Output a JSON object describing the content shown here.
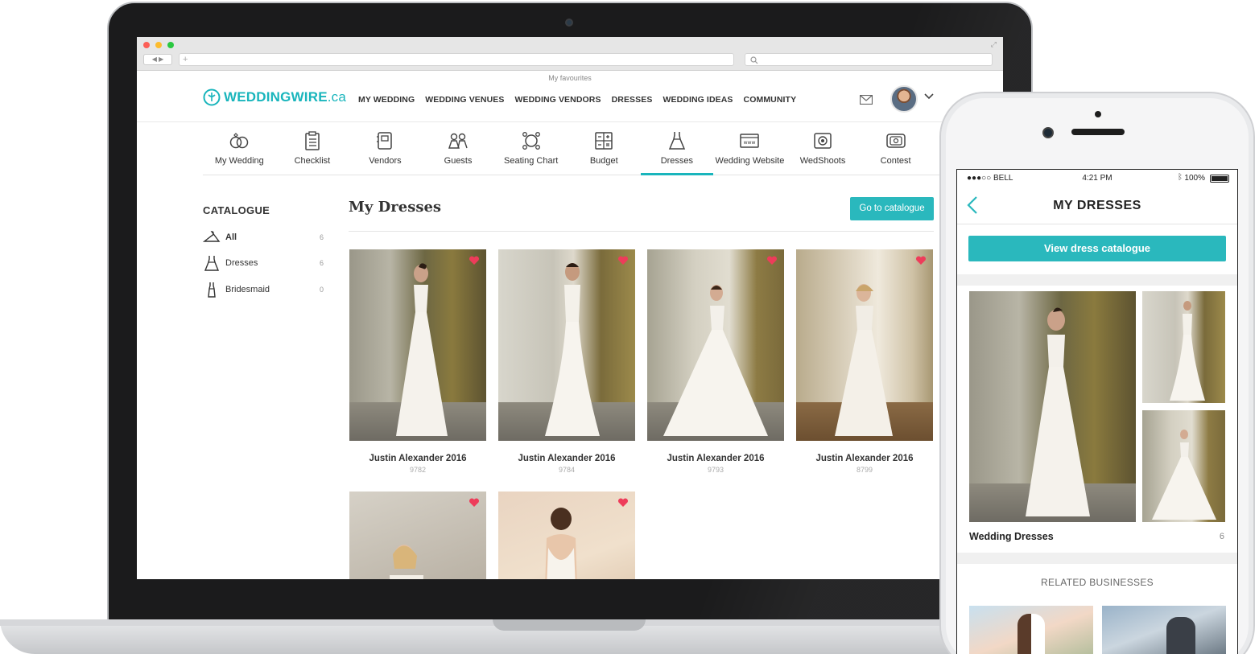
{
  "browser": {
    "favourites_label": "My favourites"
  },
  "site": {
    "logo_main": "WEDDINGWIRE",
    "logo_suffix": ".ca",
    "nav": [
      "MY WEDDING",
      "WEDDING VENUES",
      "WEDDING VENDORS",
      "DRESSES",
      "WEDDING IDEAS",
      "COMMUNITY"
    ],
    "accent_color": "#2ab8bd"
  },
  "tools": [
    {
      "label": "My Wedding",
      "icon": "rings-icon"
    },
    {
      "label": "Checklist",
      "icon": "checklist-icon"
    },
    {
      "label": "Vendors",
      "icon": "vendors-icon"
    },
    {
      "label": "Guests",
      "icon": "guests-icon"
    },
    {
      "label": "Seating Chart",
      "icon": "seating-chart-icon"
    },
    {
      "label": "Budget",
      "icon": "budget-icon"
    },
    {
      "label": "Dresses",
      "icon": "dress-icon",
      "active": true
    },
    {
      "label": "Wedding Website",
      "icon": "website-icon"
    },
    {
      "label": "WedShoots",
      "icon": "camera-icon"
    },
    {
      "label": "Contest",
      "icon": "contest-icon"
    }
  ],
  "sidebar": {
    "title": "CATALOGUE",
    "items": [
      {
        "label": "All",
        "count": "6",
        "icon": "hanger-icon",
        "selected": true
      },
      {
        "label": "Dresses",
        "count": "6",
        "icon": "dress-icon"
      },
      {
        "label": "Bridesmaid",
        "count": "0",
        "icon": "bridesmaid-dress-icon"
      }
    ]
  },
  "main": {
    "title": "My Dresses",
    "catalogue_button": "Go to catalogue",
    "cards": [
      {
        "name": "Justin Alexander 2016",
        "code": "9782"
      },
      {
        "name": "Justin Alexander 2016",
        "code": "9784"
      },
      {
        "name": "Justin Alexander 2016",
        "code": "9793"
      },
      {
        "name": "Justin Alexander 2016",
        "code": "8799"
      },
      {
        "name": "",
        "code": ""
      },
      {
        "name": "",
        "code": ""
      }
    ]
  },
  "phone": {
    "carrier": "●●●○○ BELL",
    "time": "4:21 PM",
    "battery": "100%",
    "title": "MY DRESSES",
    "button": "View dress catalogue",
    "album_label": "Wedding Dresses",
    "album_count": "6",
    "related_title": "RELATED BUSINESSES"
  }
}
